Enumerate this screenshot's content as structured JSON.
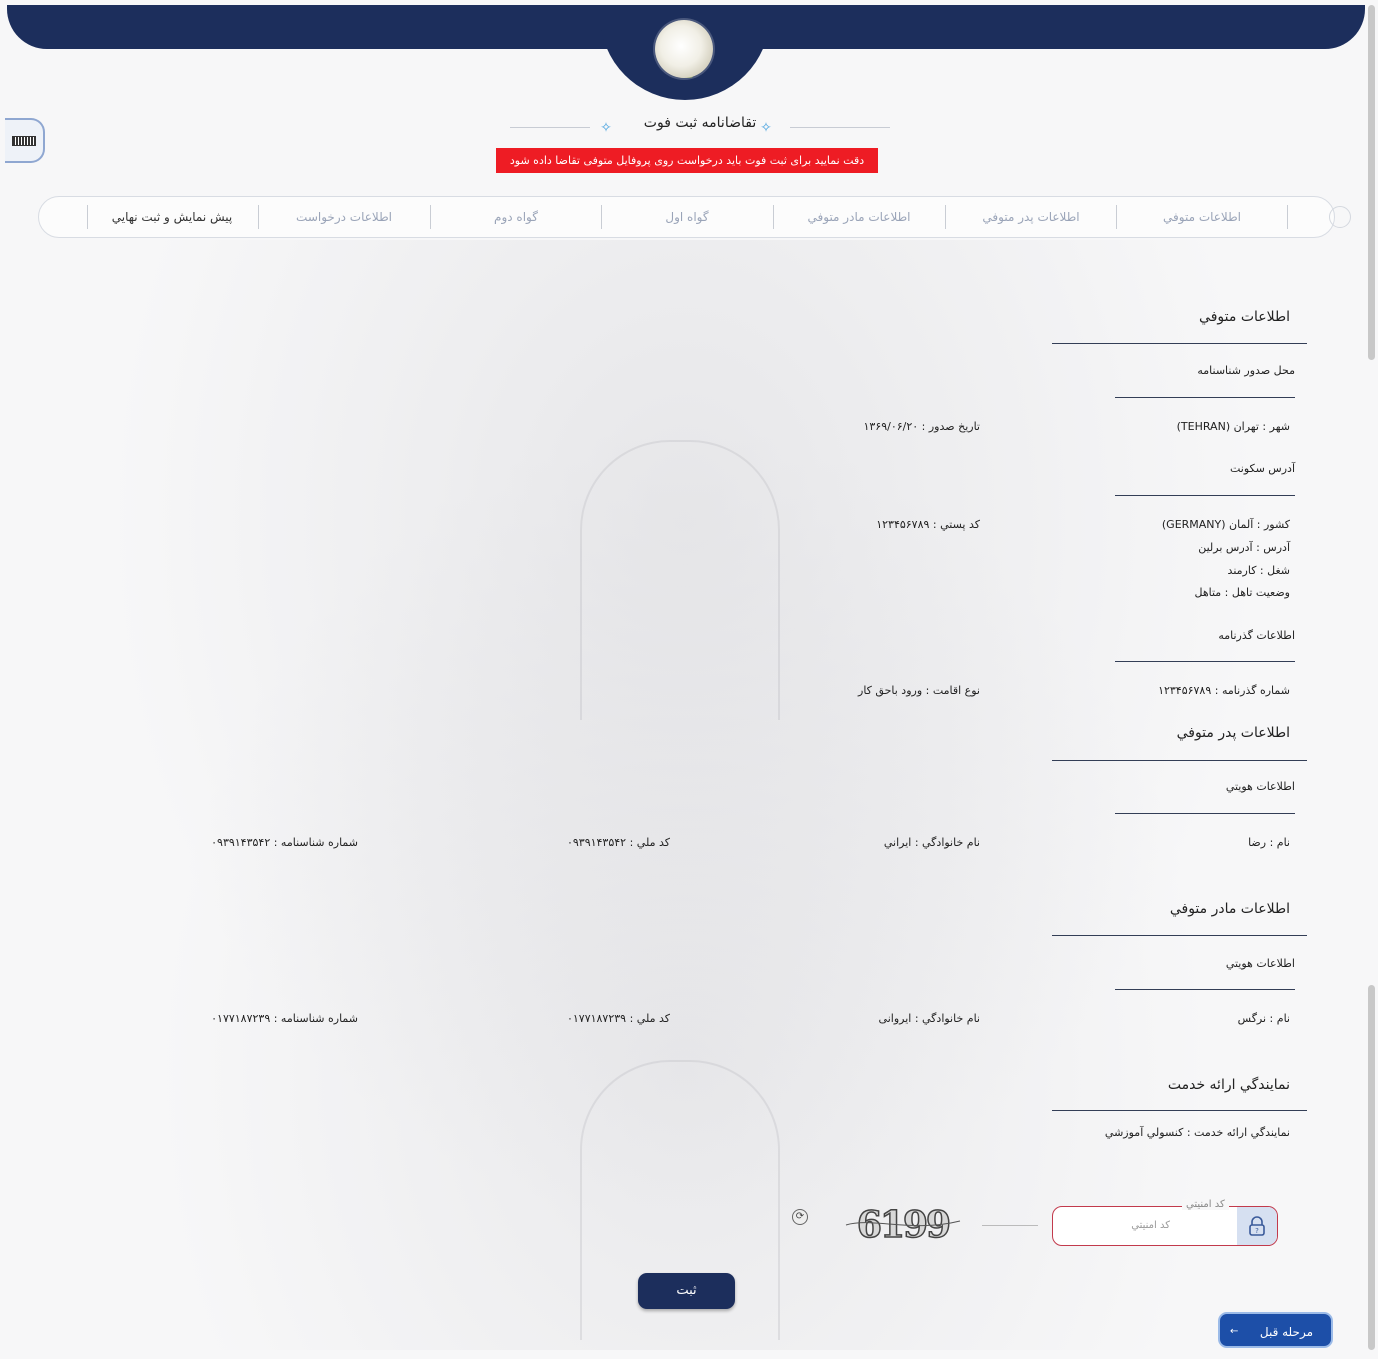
{
  "header": {
    "title": "تقاضانامه ثبت فوت",
    "alert": "دقت نمایید برای ثبت فوت باید درخواست روی پروفایل متوفی تقاضا داده شود"
  },
  "steps": [
    {
      "label": "اطلاعات متوفي",
      "active": false
    },
    {
      "label": "اطلاعات پدر متوفي",
      "active": false
    },
    {
      "label": "اطلاعات مادر متوفي",
      "active": false
    },
    {
      "label": "گواه اول",
      "active": false
    },
    {
      "label": "گواه دوم",
      "active": false
    },
    {
      "label": "اطلاعات درخواست",
      "active": false
    },
    {
      "label": "پيش نمايش و ثبت نهايي",
      "active": true
    }
  ],
  "deceased": {
    "title": "اطلاعات متوفي",
    "id_issue_place": "محل صدور شناسنامه",
    "city": "شهر : تهران (TEHRAN)",
    "issue_date": "تاريخ صدور : ۱۳۶۹/۰۶/۲۰",
    "residence_address": "آدرس سکونت",
    "country": "کشور : آلمان (GERMANY)",
    "postal_code": "کد پستي : ۱۲۳۴۵۶۷۸۹",
    "address": "آدرس : آدرس برلین",
    "job": "شغل : کارمند",
    "marital_status": "وضعيت تاهل : متاهل",
    "passport_info": "اطلاعات گذرنامه",
    "passport_number": "شماره گذرنامه : ۱۲۳۴۵۶۷۸۹",
    "residence_type": "نوع اقامت : ورود باحق کار"
  },
  "father": {
    "title": "اطلاعات پدر متوفي",
    "identity": "اطلاعات هويتي",
    "name": "نام : رضا",
    "family": "نام خانوادگي : ايراني",
    "national_code": "کد ملي : ۰۹۳۹۱۴۳۵۴۲",
    "id_number": "شماره شناسنامه : ۰۹۳۹۱۴۳۵۴۲"
  },
  "mother": {
    "title": "اطلاعات مادر متوفي",
    "identity": "اطلاعات هويتي",
    "name": "نام : نرگس",
    "family": "نام خانوادگي : ايروانی",
    "national_code": "کد ملي : ۰۱۷۷۱۸۷۲۳۹",
    "id_number": "شماره شناسنامه : ۰۱۷۷۱۸۷۲۳۹"
  },
  "service": {
    "title": "نمايندگي ارائه خدمت",
    "value": "نمايندگي ارائه خدمت : کنسولي آموزشي"
  },
  "captcha": {
    "legend": "کد امنيتي",
    "placeholder": "کد امنيتي",
    "code": "6199"
  },
  "buttons": {
    "submit": "ثبت",
    "previous": "مرحله قبل"
  },
  "colors": {
    "primary": "#1c2e5c",
    "alert": "#ee1c24",
    "prev_button": "#1d4fa8"
  }
}
